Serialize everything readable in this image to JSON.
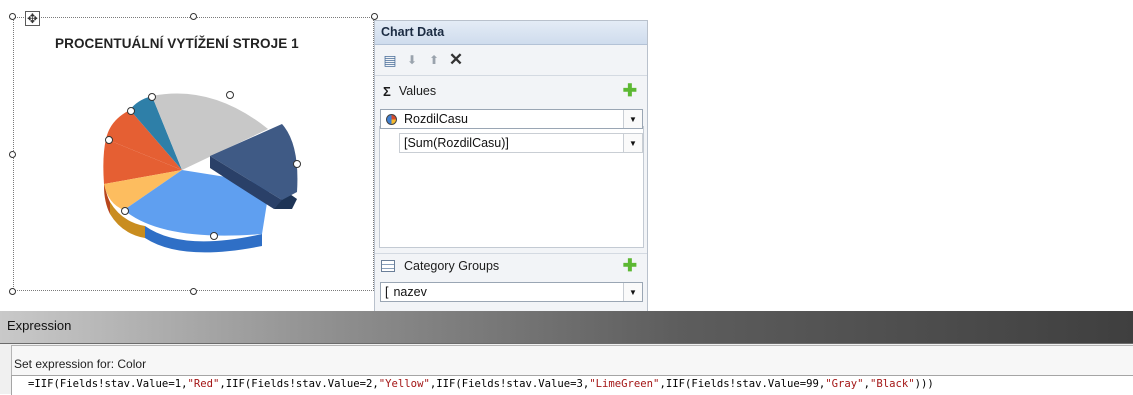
{
  "chart": {
    "title": "PROCENTUÁLNÍ VYTÍŽENÍ STROJE 1",
    "type": "3d-pie",
    "slice_colors": [
      "#5B9BD5",
      "#ED7D31",
      "#A5A5A5",
      "#FFC000",
      "#4472C4",
      "#264478"
    ]
  },
  "chart_data_pane": {
    "title": "Chart Data",
    "values_label": "Values",
    "values_field": "RozdilCasu",
    "values_expression": "[Sum(RozdilCasu)]",
    "category_groups_label": "Category Groups",
    "category_field": "nazev"
  },
  "expression_dialog": {
    "title": "Expression",
    "label": "Set expression for: Color",
    "expression_parts": [
      "=IIF(Fields!stav.Value=1,",
      "\"Red\"",
      ",IIF(Fields!stav.Value=2,",
      "\"Yellow\"",
      ",IIF(Fields!stav.Value=3,",
      "\"LimeGreen\"",
      ",IIF(Fields!stav.Value=99,",
      "\"Gray\"",
      ",",
      "\"Black\"",
      ")))"
    ]
  }
}
